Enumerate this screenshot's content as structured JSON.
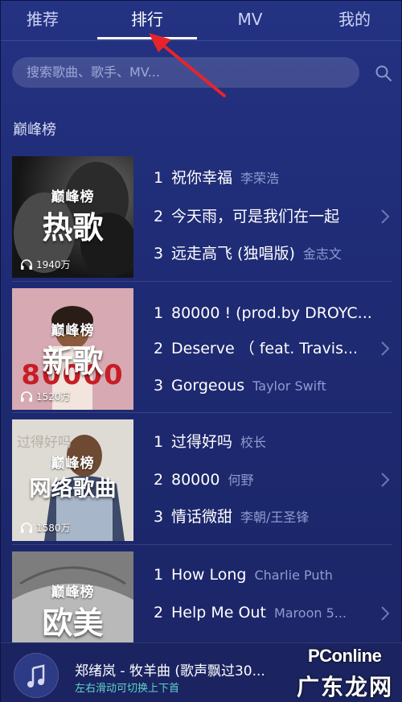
{
  "tabs": [
    {
      "label": "推荐"
    },
    {
      "label": "排行"
    },
    {
      "label": "MV"
    },
    {
      "label": "我的"
    }
  ],
  "search": {
    "placeholder": "搜索歌曲、歌手、MV..."
  },
  "section_title": "巅峰榜",
  "charts": [
    {
      "logo": "巅峰榜",
      "title": "热歌",
      "plays": "1940万",
      "songs": [
        {
          "num": "1",
          "name": "祝你幸福",
          "artist": "李荣浩"
        },
        {
          "num": "2",
          "name": "今天雨，可是我们在一起",
          "artist": ""
        },
        {
          "num": "3",
          "name": "远走高飞 (独唱版)",
          "artist": "金志文"
        }
      ]
    },
    {
      "logo": "巅峰榜",
      "title": "新歌",
      "plays": "1520万",
      "cover_text": "80000",
      "songs": [
        {
          "num": "1",
          "name": "80000 ! (prod.by DROYC...",
          "artist": ""
        },
        {
          "num": "2",
          "name": "Deserve （ feat. Travis...",
          "artist": ""
        },
        {
          "num": "3",
          "name": "Gorgeous",
          "artist": "Taylor Swift"
        }
      ]
    },
    {
      "logo": "巅峰榜",
      "title": "网络歌曲",
      "plays": "1580万",
      "cover_text": "过得好吗",
      "songs": [
        {
          "num": "1",
          "name": "过得好吗",
          "artist": "校长"
        },
        {
          "num": "2",
          "name": "80000",
          "artist": "何野"
        },
        {
          "num": "3",
          "name": "情话微甜",
          "artist": "李朝/王圣锋"
        }
      ]
    },
    {
      "logo": "巅峰榜",
      "title": "欧美",
      "plays": "",
      "songs": [
        {
          "num": "1",
          "name": "How Long",
          "artist": "Charlie Puth"
        },
        {
          "num": "2",
          "name": "Help Me Out",
          "artist": "Maroon 5..."
        }
      ]
    }
  ],
  "player": {
    "title": "郑绪岚 - 牧羊曲 (歌声飘过30...",
    "hint": "左右滑动可切换上下首"
  },
  "watermark": {
    "line1": "PConline",
    "line2": "广东龙网"
  },
  "colors": {
    "accent": "#5fd3c8",
    "background": "#1f2a78",
    "annotation": "#e8242b"
  }
}
